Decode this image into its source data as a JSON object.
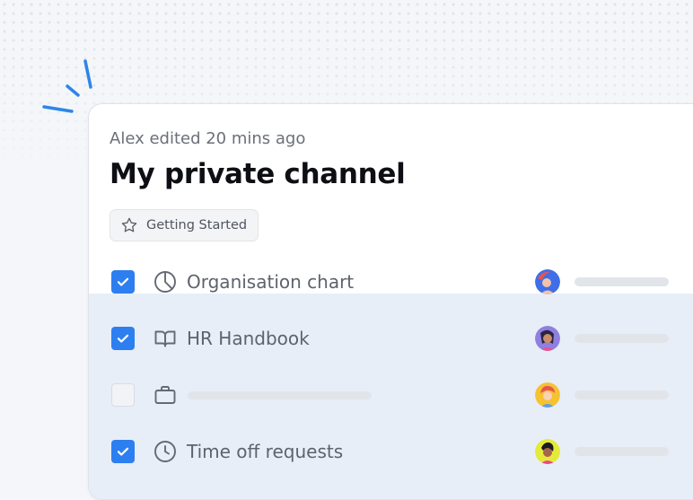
{
  "doc": {
    "meta": "Alex edited 20 mins ago",
    "title": "My private channel",
    "tag": {
      "label": "Getting Started",
      "icon": "star-icon"
    }
  },
  "rows": [
    {
      "label": "Organisation chart",
      "checked": true,
      "icon": "pie-chart-icon"
    },
    {
      "label": "HR Handbook",
      "checked": true,
      "icon": "book-icon"
    },
    {
      "label": "",
      "checked": false,
      "icon": "briefcase-icon"
    },
    {
      "label": "Time off requests",
      "checked": true,
      "icon": "clock-icon"
    }
  ],
  "colors": {
    "accent": "#2d7ff0",
    "highlight": "#e7eef8",
    "sparkle": "#2d86e8"
  }
}
